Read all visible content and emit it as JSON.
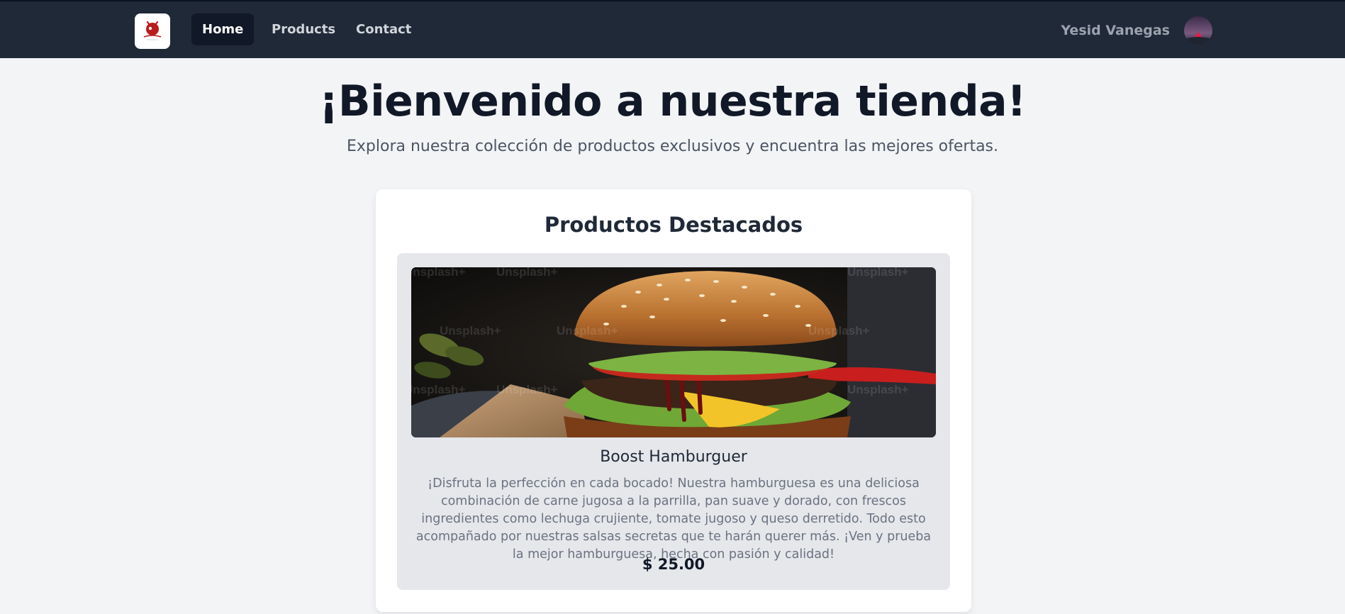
{
  "nav": {
    "logo_alt": "Restaurant",
    "links": [
      {
        "label": "Home",
        "active": true
      },
      {
        "label": "Products",
        "active": false
      },
      {
        "label": "Contact",
        "active": false
      }
    ],
    "user_name": "Yesid Vanegas"
  },
  "hero": {
    "title": "¡Bienvenido a nuestra tienda!",
    "subtitle": "Explora nuestra colección de productos exclusivos y encuentra las mejores ofertas."
  },
  "featured": {
    "title": "Productos Destacados",
    "product": {
      "image_watermark": "Unsplash+",
      "name": "Boost Hamburguer",
      "description": "¡Disfruta la perfección en cada bocado! Nuestra hamburguesa es una deliciosa combinación de carne jugosa a la parrilla, pan suave y dorado, con frescos ingredientes como lechuga crujiente, tomate jugoso y queso derretido. Todo esto acompañado por nuestras salsas secretas que te harán querer más. ¡Ven y prueba la mejor hamburguesa, hecha con pasión y calidad!",
      "price": "$ 25.00"
    }
  },
  "colors": {
    "navbar": "#1f2937",
    "page_bg": "#f3f4f6",
    "card_bg": "#ffffff",
    "product_bg": "#e5e7eb"
  }
}
